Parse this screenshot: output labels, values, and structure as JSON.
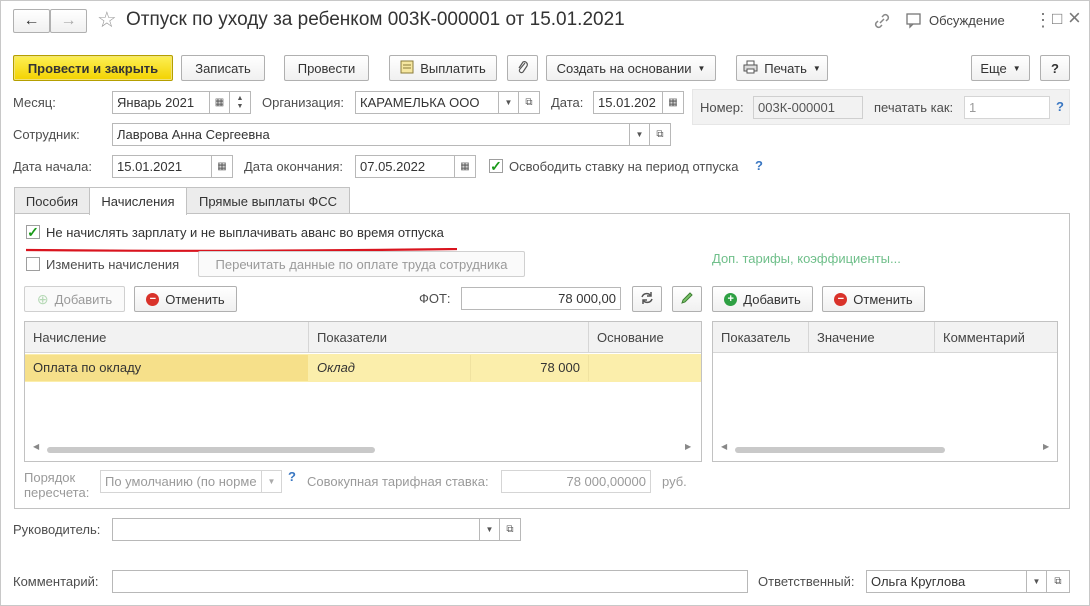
{
  "title": "Отпуск по уходу за ребенком 003К-000001 от 15.01.2021",
  "header": {
    "discussion": "Обсуждение",
    "back_glyph": "←",
    "forward_glyph": "→",
    "star_glyph": "☆",
    "menu_glyph": "⋮",
    "maximize_glyph": "□",
    "close_glyph": "×"
  },
  "toolbar": {
    "post_close": "Провести и закрыть",
    "save": "Записать",
    "post": "Провести",
    "pay": "Выплатить",
    "create_based": "Создать на основании",
    "print": "Печать",
    "more": "Еще",
    "help": "?"
  },
  "form": {
    "month_label": "Месяц:",
    "month_value": "Январь 2021",
    "org_label": "Организация:",
    "org_value": "КАРАМЕЛЬКА ООО",
    "date_label": "Дата:",
    "date_value": "15.01.202",
    "number_label": "Номер:",
    "number_value": "003К-000001",
    "print_as_label": "печатать как:",
    "print_as_placeholder": "1",
    "employee_label": "Сотрудник:",
    "employee_value": "Лаврова Анна Сергеевна",
    "start_label": "Дата начала:",
    "start_value": "15.01.2021",
    "end_label": "Дата окончания:",
    "end_value": "07.05.2022",
    "release_rate_label": "Освободить ставку на период отпуска",
    "release_rate_checked": true,
    "help_q": "?"
  },
  "tabs": [
    {
      "label": "Пособия",
      "active": false
    },
    {
      "label": "Начисления",
      "active": true
    },
    {
      "label": "Прямые выплаты ФСС",
      "active": false
    }
  ],
  "accruals": {
    "no_salary_label": "Не начислять зарплату и не выплачивать аванс во время отпуска",
    "no_salary_checked": true,
    "change_label": "Изменить начисления",
    "change_checked": false,
    "reread_button": "Перечитать данные по оплате труда сотрудника",
    "extra_link": "Доп. тарифы, коэффициенты...",
    "add_button": "Добавить",
    "cancel_button": "Отменить",
    "fot_label": "ФОТ:",
    "fot_value": "78 000,00",
    "right_add_button": "Добавить",
    "right_cancel_button": "Отменить",
    "left_columns": [
      "Начисление",
      "Показатели",
      "",
      "Основание"
    ],
    "left_rows": [
      {
        "accrual": "Оплата по окладу",
        "indicator": "Оклад",
        "value": "78 000",
        "basis": ""
      }
    ],
    "right_columns": [
      "Показатель",
      "Значение",
      "Комментарий"
    ],
    "recalc_label_1": "Порядок",
    "recalc_label_2": "пересчета:",
    "recalc_value": "По умолчанию (по норме",
    "total_rate_label": "Совокупная тарифная ставка:",
    "total_rate_value": "78 000,00000",
    "currency": "руб."
  },
  "footer": {
    "manager_label": "Руководитель:",
    "manager_value": "",
    "comment_label": "Комментарий:",
    "comment_value": "",
    "responsible_label": "Ответственный:",
    "responsible_value": "Ольга Круглова"
  },
  "colors": {
    "accent_yellow": "#f3d200",
    "link_blue": "#3a77c2",
    "link_green": "#6fbf8a",
    "underline_red": "#d9141e",
    "row_selected": "#fbeeab"
  }
}
